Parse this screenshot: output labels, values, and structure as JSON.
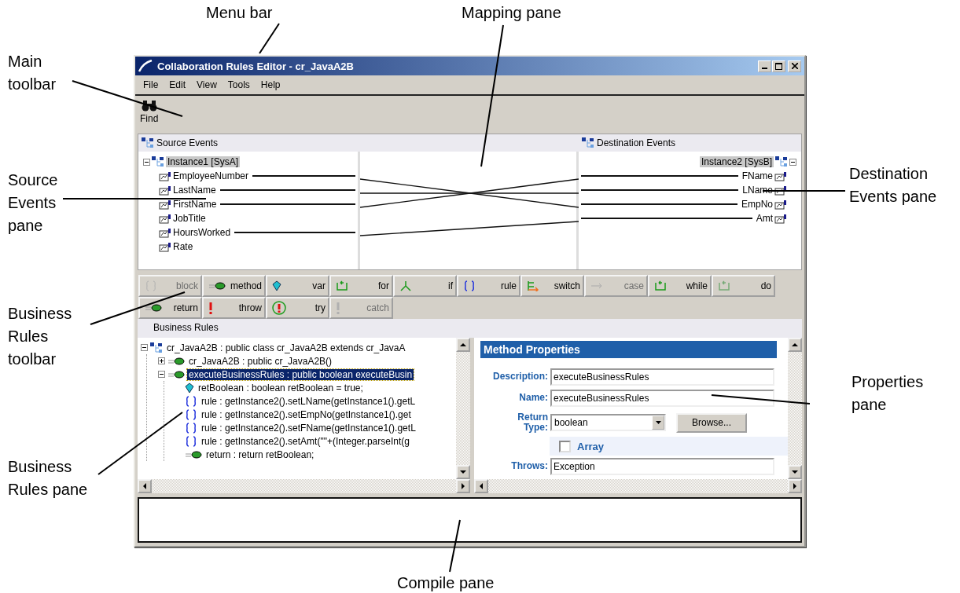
{
  "callouts": [
    {
      "text": "Menu bar"
    },
    {
      "text": "Mapping pane"
    },
    {
      "text": "Main\ntoolbar"
    },
    {
      "text": "Source\nEvents\npane"
    },
    {
      "text": "Destination\nEvents pane"
    },
    {
      "text": "Business\nRules\ntoolbar"
    },
    {
      "text": "Properties\npane"
    },
    {
      "text": "Business\nRules pane"
    },
    {
      "text": "Compile pane"
    }
  ],
  "window": {
    "title": "Collaboration Rules Editor - cr_JavaA2B"
  },
  "menu": [
    "File",
    "Edit",
    "View",
    "Tools",
    "Help"
  ],
  "toolbar": [
    {
      "label": "Find"
    }
  ],
  "source_events": {
    "header": "Source Events",
    "instance": {
      "label": "Instance1 [SysA]",
      "expanded": true
    },
    "fields": [
      {
        "name": "EmployeeNumber",
        "mapped": true
      },
      {
        "name": "LastName",
        "mapped": true
      },
      {
        "name": "FirstName",
        "mapped": true
      },
      {
        "name": "JobTitle",
        "mapped": false
      },
      {
        "name": "HoursWorked",
        "mapped": true
      },
      {
        "name": "Rate",
        "mapped": false
      }
    ]
  },
  "destination_events": {
    "header": "Destination Events",
    "instance": {
      "label": "Instance2 [SysB]",
      "expanded": true
    },
    "fields": [
      {
        "name": "FName",
        "mapped": true
      },
      {
        "name": "LName",
        "mapped": true
      },
      {
        "name": "EmpNo",
        "mapped": true
      },
      {
        "name": "Amt",
        "mapped": true
      }
    ]
  },
  "rules_toolbar": [
    [
      {
        "label": "block",
        "kind": "block",
        "disabled": true
      },
      {
        "label": "method",
        "kind": "method",
        "disabled": false
      },
      {
        "label": "var",
        "kind": "var",
        "disabled": false
      },
      {
        "label": "for",
        "kind": "for",
        "disabled": false
      },
      {
        "label": "if",
        "kind": "if",
        "disabled": false
      },
      {
        "label": "rule",
        "kind": "rule",
        "disabled": false
      },
      {
        "label": "switch",
        "kind": "switch",
        "disabled": false
      },
      {
        "label": "case",
        "kind": "case",
        "disabled": true
      },
      {
        "label": "while",
        "kind": "while",
        "disabled": false
      },
      {
        "label": "do",
        "kind": "do",
        "disabled": false
      }
    ],
    [
      {
        "label": "return",
        "kind": "return",
        "disabled": false
      },
      {
        "label": "throw",
        "kind": "throw",
        "disabled": false
      },
      {
        "label": "try",
        "kind": "try",
        "disabled": false
      },
      {
        "label": "catch",
        "kind": "catch",
        "disabled": true
      }
    ]
  ],
  "business_rules": {
    "header": "Business Rules",
    "tree": [
      {
        "label": "cr_JavaA2B : public class cr_JavaA2B extends cr_JavaA",
        "kind": "class",
        "expanded": true,
        "selected": false,
        "children": [
          {
            "label": "cr_JavaA2B : public  cr_JavaA2B()",
            "kind": "method",
            "expanded": false,
            "selected": false
          },
          {
            "label": "executeBusinessRules : public boolean executeBusin",
            "kind": "method",
            "expanded": true,
            "selected": true,
            "children": [
              {
                "label": "retBoolean : boolean retBoolean = true;",
                "kind": "var",
                "selected": false
              },
              {
                "label": "rule : getInstance2().setLName(getInstance1().getL",
                "kind": "rule",
                "selected": false
              },
              {
                "label": "rule : getInstance2().setEmpNo(getInstance1().get",
                "kind": "rule",
                "selected": false
              },
              {
                "label": "rule : getInstance2().setFName(getInstance1().getL",
                "kind": "rule",
                "selected": false
              },
              {
                "label": "rule : getInstance2().setAmt(\"\"+(Integer.parseInt(g",
                "kind": "rule",
                "selected": false
              },
              {
                "label": "return : return retBoolean;",
                "kind": "return",
                "selected": false
              }
            ]
          }
        ]
      }
    ]
  },
  "properties": {
    "title": "Method Properties",
    "fields": [
      {
        "kind": "text",
        "label": "Description:",
        "value": "executeBusinessRules"
      },
      {
        "kind": "text",
        "label": "Name:",
        "value": "executeBusinessRules"
      },
      {
        "kind": "select",
        "label": "Return\nType:",
        "value": "boolean",
        "button": "Browse..."
      },
      {
        "kind": "checkbox",
        "label": "Array",
        "checked": false
      },
      {
        "kind": "text",
        "label": "Throws:",
        "value": "Exception"
      }
    ]
  }
}
